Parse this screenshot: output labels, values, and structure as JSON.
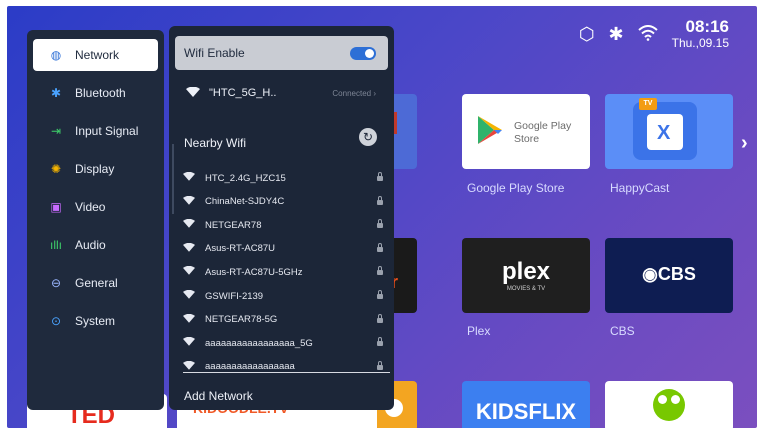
{
  "status_bar": {
    "time": "08:16",
    "date": "Thu.,09.15",
    "icons": [
      "settings-icon",
      "bluetooth-icon",
      "wifi-icon"
    ]
  },
  "apps": [
    {
      "name": "Google Play Store",
      "tile_text": "Google Play\nStore"
    },
    {
      "name": "HappyCast",
      "tile_text": ""
    },
    {
      "name": "Plex",
      "tile_text": "plex",
      "subtext": "MOVIES & TV"
    },
    {
      "name": "CBS",
      "tile_text": "◉CBS"
    },
    {
      "name": "",
      "tile_text": "KIDSFLIX"
    }
  ],
  "settings_menu": {
    "items": [
      {
        "label": "Network",
        "icon": "globe-icon",
        "active": true
      },
      {
        "label": "Bluetooth",
        "icon": "bluetooth-icon"
      },
      {
        "label": "Input Signal",
        "icon": "input-icon"
      },
      {
        "label": "Display",
        "icon": "brightness-icon"
      },
      {
        "label": "Video",
        "icon": "video-icon"
      },
      {
        "label": "Audio",
        "icon": "audio-icon"
      },
      {
        "label": "General",
        "icon": "general-icon"
      },
      {
        "label": "System",
        "icon": "system-icon"
      }
    ]
  },
  "wifi_panel": {
    "wifi_enable_label": "Wifi Enable",
    "wifi_enabled": true,
    "connected_network": "\"HTC_5G_H..",
    "connected_status": "Connected",
    "nearby_title": "Nearby Wifi",
    "networks": [
      "HTC_2.4G_HZC15",
      "ChinaNet-SJDY4C",
      "NETGEAR78",
      "Asus-RT-AC87U",
      "Asus-RT-AC87U-5GHz",
      "GSWIFI-2139",
      "NETGEAR78-5G",
      "aaaaaaaaaaaaaaaaa_5G",
      "aaaaaaaaaaaaaaaaa"
    ],
    "add_network_label": "Add Network"
  }
}
